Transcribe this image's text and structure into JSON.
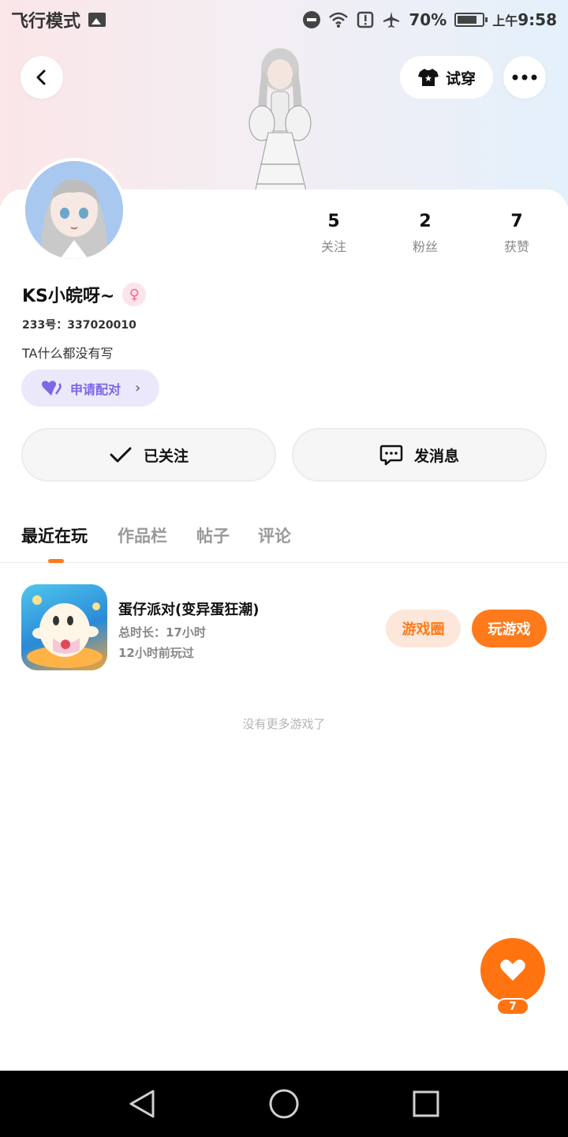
{
  "status_bar": {
    "mode_label": "飞行模式",
    "battery": "70%",
    "time_prefix": "上午",
    "time": "9:58"
  },
  "header": {
    "tryon_label": "试穿"
  },
  "profile": {
    "username": "KS小皖呀~",
    "gender_symbol": "♀",
    "uid": "233号：337020010",
    "bio": "TA什么都没有写",
    "pair_label": "申请配对"
  },
  "stats": [
    {
      "value": "5",
      "label": "关注"
    },
    {
      "value": "2",
      "label": "粉丝"
    },
    {
      "value": "7",
      "label": "获赞"
    }
  ],
  "actions": {
    "follow_label": "已关注",
    "message_label": "发消息"
  },
  "tabs": [
    {
      "label": "最近在玩",
      "active": true
    },
    {
      "label": "作品栏",
      "active": false
    },
    {
      "label": "帖子",
      "active": false
    },
    {
      "label": "评论",
      "active": false
    }
  ],
  "games": [
    {
      "title": "蛋仔派对(变异蛋狂潮)",
      "duration": "总时长：17小时",
      "last_played": "12小时前玩过",
      "circle_label": "游戏圈",
      "play_label": "玩游戏"
    }
  ],
  "footer_note": "没有更多游戏了",
  "likes": {
    "count": "7"
  },
  "colors": {
    "accent": "#ff7a1a",
    "pair": "#7b67e8"
  }
}
